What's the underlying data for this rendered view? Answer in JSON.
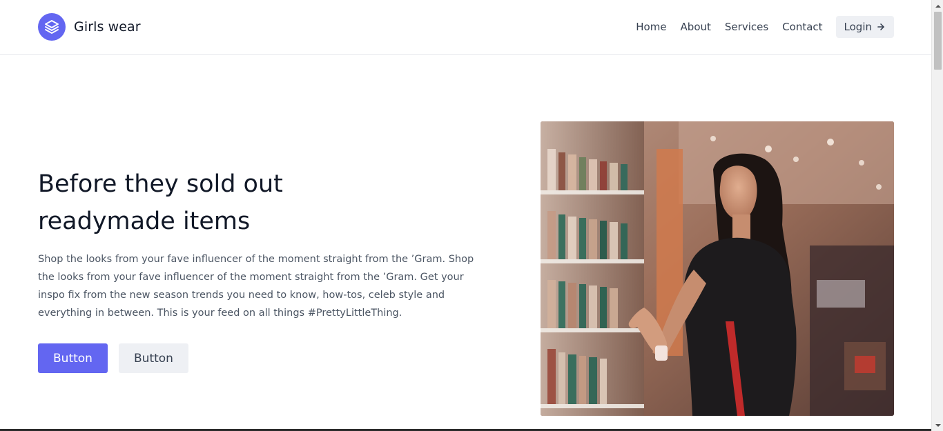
{
  "brand": {
    "name": "Girls wear",
    "logo_icon": "stack-layers-icon",
    "accent": "#6366f1"
  },
  "nav": {
    "items": [
      {
        "label": "Home"
      },
      {
        "label": "About"
      },
      {
        "label": "Services"
      },
      {
        "label": "Contact"
      }
    ],
    "login_label": "Login",
    "login_icon": "arrow-right-icon"
  },
  "hero": {
    "title_line1": "Before they sold out",
    "title_line2": "readymade items",
    "text": "Shop the looks from your fave influencer of the moment straight from the ’Gram. Shop the looks from your fave influencer of the moment straight from the ’Gram. Get your inspo fix from the new season trends you need to know, how-tos, celeb style and everything in between. This is your feed on all things #PrettyLittleThing.",
    "primary_button": "Button",
    "secondary_button": "Button",
    "image_icon": "shopping-woman-photo"
  }
}
